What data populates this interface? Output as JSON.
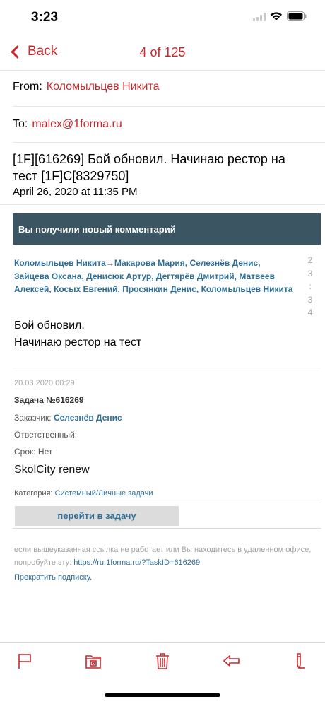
{
  "status": {
    "time": "3:23"
  },
  "nav": {
    "back_label": "Back",
    "counter": "4 of 125"
  },
  "header": {
    "from_label": "From:",
    "from_name": "Коломыльцев Никита",
    "to_label": "To:",
    "to_addr": "malex@1forma.ru",
    "subject": "[1F][616269] Бой обновил. Начинаю рестор на тест [1F]C[8329750]",
    "date": "April 26, 2020 at 11:35 PM"
  },
  "body": {
    "banner": "Вы получили новый комментарий",
    "participants": {
      "author": "Коломыльцев Никита",
      "arrow": "→",
      "recipients": [
        "Макарова Мария",
        "Селезнёв Денис",
        "Зайцева Оксана",
        "Денисюк Артур",
        "Дегтярёв Дмитрий",
        "Матвеев Алексей",
        "Косых Евгений",
        "Просянкин Денис",
        "Коломыльцев Никита"
      ]
    },
    "pager": [
      "2",
      "3",
      ":",
      "3",
      "4"
    ],
    "comment_lines": [
      "Бой обновил.",
      "Начинаю рестор на тест"
    ],
    "task": {
      "date": "20.03.2020 00:29",
      "number": "Задача №616269",
      "customer_label": "Заказчик:",
      "customer_name": "Селезнёв Денис",
      "responsible": "Ответственный:",
      "deadline": "Срок: Нет",
      "title": "SkolCity renew",
      "category_label": "Категория:",
      "category_value": "Системный/Личные задачи"
    },
    "go_button": "перейти в задачу",
    "fallback_text": "если вышеуказанная ссылка не работает или Вы находитесь в удаленном офисе, попробуйте эту:",
    "fallback_link": "https://ru.1forma.ru/?TaskID=616269",
    "unsubscribe": "Прекратить подписку",
    "unsubscribe_dot": "."
  },
  "toolbar": {
    "icons": [
      "flag-icon",
      "folder-icon",
      "trash-icon",
      "reply-icon",
      "compose-icon"
    ],
    "accent": "#c8282d"
  },
  "colors": {
    "accent": "#c8282d",
    "link": "#2e6f97",
    "banner": "#3b5563"
  }
}
